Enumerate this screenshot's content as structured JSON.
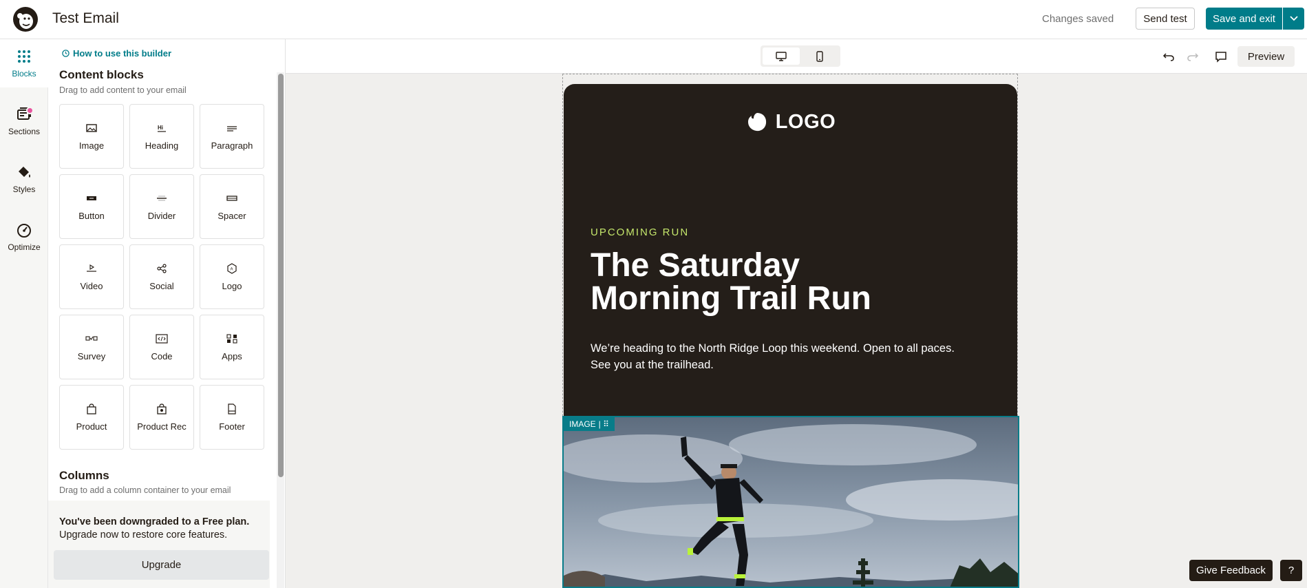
{
  "header": {
    "title": "Test Email",
    "status": "Changes saved",
    "send_test_label": "Send test",
    "save_exit_label": "Save and exit"
  },
  "rail": {
    "items": [
      {
        "label": "Blocks",
        "icon": "grid-dots-icon"
      },
      {
        "label": "Sections",
        "icon": "sections-icon"
      },
      {
        "label": "Styles",
        "icon": "paint-bucket-icon"
      },
      {
        "label": "Optimize",
        "icon": "gauge-icon"
      }
    ]
  },
  "panel": {
    "howto": "How to use this builder",
    "content_title": "Content blocks",
    "content_sub": "Drag to add content to your email",
    "blocks": [
      {
        "label": "Image",
        "icon": "image-icon"
      },
      {
        "label": "Heading",
        "icon": "heading-icon"
      },
      {
        "label": "Paragraph",
        "icon": "paragraph-icon"
      },
      {
        "label": "Button",
        "icon": "button-icon"
      },
      {
        "label": "Divider",
        "icon": "divider-icon"
      },
      {
        "label": "Spacer",
        "icon": "spacer-icon"
      },
      {
        "label": "Video",
        "icon": "video-icon"
      },
      {
        "label": "Social",
        "icon": "share-icon"
      },
      {
        "label": "Logo",
        "icon": "logo-badge-icon"
      },
      {
        "label": "Survey",
        "icon": "survey-icon"
      },
      {
        "label": "Code",
        "icon": "code-icon"
      },
      {
        "label": "Apps",
        "icon": "apps-icon"
      },
      {
        "label": "Product",
        "icon": "shopping-bag-icon"
      },
      {
        "label": "Product Rec",
        "icon": "product-rec-icon"
      },
      {
        "label": "Footer",
        "icon": "footer-icon"
      }
    ],
    "columns_title": "Columns",
    "columns_sub": "Drag to add a column container to your email"
  },
  "promo": {
    "title": "You've been downgraded to a Free plan.",
    "sub": "Upgrade now to restore core features.",
    "button": "Upgrade"
  },
  "canvas": {
    "preview_label": "Preview"
  },
  "email": {
    "logo_text": "LOGO",
    "eyebrow": "UPCOMING RUN",
    "title_line1": "The Saturday",
    "title_line2": "Morning Trail Run",
    "body_line1": "We’re heading to the North Ridge Loop this weekend. Open to all paces.",
    "body_line2": "See you at the trailhead.",
    "image_tag": "IMAGE"
  },
  "footer": {
    "feedback_label": "Give Feedback",
    "help_label": "?"
  },
  "colors": {
    "accent": "#007c89",
    "hero_bg": "#241e19",
    "eyebrow": "#c4e66b",
    "badge": "#e8559f"
  }
}
